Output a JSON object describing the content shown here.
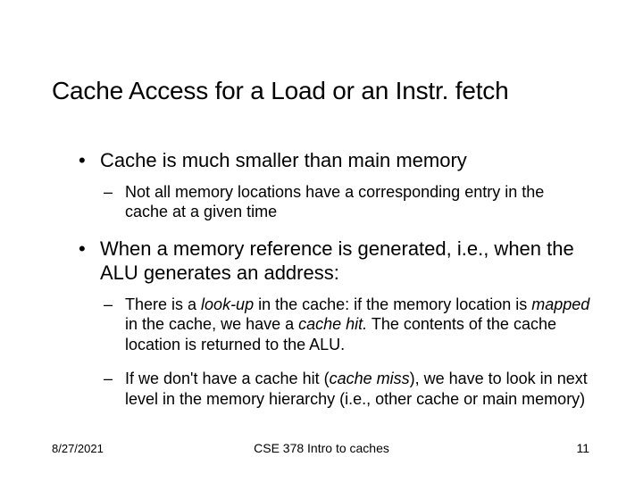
{
  "title": "Cache Access for a Load or an Instr. fetch",
  "b1": "Cache is much smaller than main memory",
  "b1_1": "Not all memory locations have a corresponding entry in the cache at a given time",
  "b2": "When a memory reference is generated, i.e., when the ALU generates an address:",
  "b2_1_pre": "There is a ",
  "b2_1_lookup": "look-up",
  "b2_1_mid1": " in the cache: if the memory location is ",
  "b2_1_mapped": "mapped",
  "b2_1_mid2": " in the cache, we have a ",
  "b2_1_hit": "cache hit.",
  "b2_1_post": " The contents of the cache location is returned to the ALU.",
  "b2_2_pre": "If we don't have a cache hit (",
  "b2_2_miss": "cache miss",
  "b2_2_post": "), we have to look in next level in the memory hierarchy (i.e., other cache or main memory)",
  "footer": {
    "date": "8/27/2021",
    "center": "CSE 378 Intro to caches",
    "page": "11"
  }
}
